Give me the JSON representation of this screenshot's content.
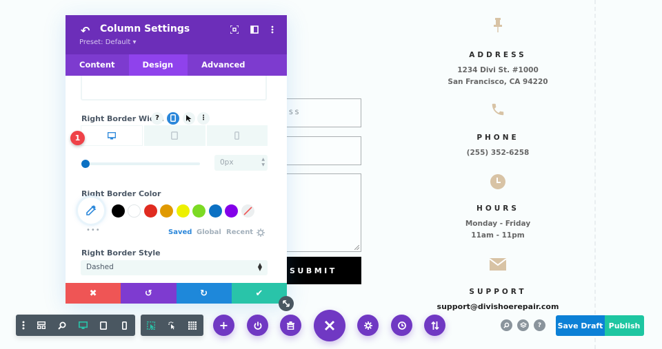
{
  "panel": {
    "title": "Column Settings",
    "preset": "Preset: Default ▾",
    "tabs": [
      {
        "label": "Content",
        "active": false
      },
      {
        "label": "Design",
        "active": true
      },
      {
        "label": "Advanced",
        "active": false
      }
    ],
    "border_width": {
      "label": "Right Border Width",
      "help_glyph": "?",
      "more_glyph": "⋮",
      "active_device": "desktop",
      "value": "0px",
      "slider_fraction": 0,
      "badge": "1"
    },
    "border_color": {
      "label": "Right Border Color",
      "swatches": [
        "#000000",
        "#ffffff",
        "#e02b20",
        "#e09900",
        "#edf000",
        "#7cda24",
        "#0c71c3",
        "#8300e9",
        "none"
      ],
      "more_glyph": "•••",
      "tabs": [
        {
          "label": "Saved",
          "active": true
        },
        {
          "label": "Global",
          "active": false
        },
        {
          "label": "Recent",
          "active": false
        }
      ]
    },
    "border_style": {
      "label": "Right Border Style",
      "value": "Dashed"
    },
    "footer_colors": {
      "cancel": "#ef5555",
      "undo": "#7e3bd0",
      "redo": "#1e88da",
      "save": "#29c4a9"
    }
  },
  "form": {
    "field1_placeholder": "RESS",
    "submit_label": "SUBMIT"
  },
  "contact": {
    "address": {
      "heading": "ADDRESS",
      "lines": [
        "1234 Divi St. #1000",
        "San Francisco, CA 94220"
      ]
    },
    "phone": {
      "heading": "PHONE",
      "lines": [
        "(255) 352-6258"
      ]
    },
    "hours": {
      "heading": "HOURS",
      "lines": [
        "Monday - Friday",
        "11am - 11pm"
      ]
    },
    "support": {
      "heading": "SUPPORT",
      "lines": [
        "support@divishoerepair.com"
      ]
    },
    "icon_color": "#d8c3a5"
  },
  "bottom_bar": {
    "save_draft": "Save Draft",
    "publish": "Publish",
    "help_glyph": "?",
    "active_view": "desktop",
    "brand_purple": "#7038c3"
  }
}
